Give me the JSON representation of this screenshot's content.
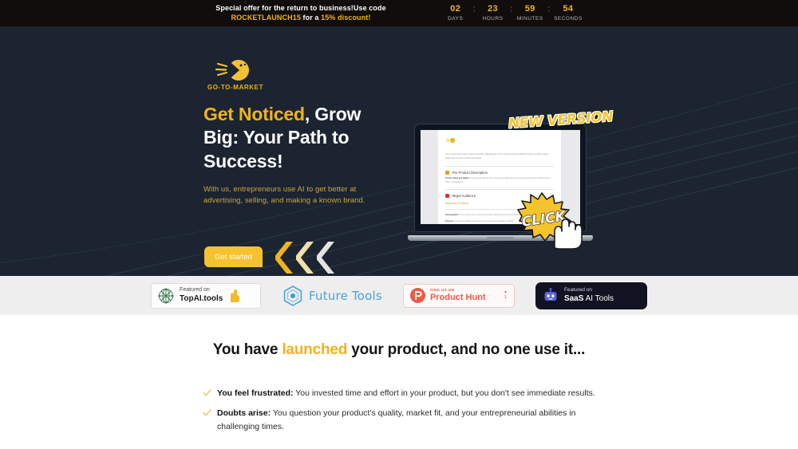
{
  "promo": {
    "line1": "Special offer for the return to business!Use code",
    "line2_code": "ROCKETLAUNCH15",
    "line2_mid": " for a ",
    "line2_pct": "15% discount!",
    "countdown": [
      {
        "value": "02",
        "label": "DAYS"
      },
      {
        "value": "23",
        "label": "HOURS"
      },
      {
        "value": "59",
        "label": "MINUTES"
      },
      {
        "value": "54",
        "label": "SECONDS"
      }
    ],
    "separator": ":"
  },
  "hero": {
    "logo_text": "GO-TO-MARKET",
    "logo_icon": "megaphone-face-icon",
    "headline_accent": "Get Noticed",
    "headline_rest": ", Grow Big: Your Path to Success!",
    "subheading": "With us, entrepreneurs use AI to get better at advertising, selling, and making a known brand.",
    "cta_label": "Get started",
    "chevrons_icon": "triple-chevron-left-icon",
    "new_version_badge": "NEW VERSION",
    "click_badge": "CLICK",
    "hand_icon": "pointing-hand-icon",
    "mock_document": {
      "intro": "Lorem ipsum dolor sit amet consectetur adipiscing elit, sed do eiusmod tempor incididunt ut labore et dolore magna aliqua enim ad minim veniam quis nostrud.",
      "intro_link": "https://",
      "sections": [
        {
          "icon": "building-icon",
          "heading": "The Product Description",
          "body_lead": "Product Name and Tagline:",
          "body": " Lorem ipsum dolor sit amet consectetur adipiscing elit sed do eiusmod tempor incididunt labore dolore magna aliqua."
        },
        {
          "icon": "flag-icon",
          "heading": "Target Audience",
          "subheading": "Audience Profiling",
          "body_lead": "Demographics:",
          "body": " Lorem ipsum dolor sit amet consectetur adipiscing elit sed do eiusmod tempor.",
          "body2_lead": "Interests:",
          "body2": " Consectetur adipiscing elit sed do eiusmod tempor incididunt ut labore."
        }
      ]
    }
  },
  "badges": {
    "topai": {
      "line1": "Featured on",
      "line2": "TopAI.tools",
      "icon": "topai-network-icon",
      "hand_icon": "pointing-hand-icon"
    },
    "futuretools": {
      "label": "Future Tools",
      "icon": "future-tools-hex-icon"
    },
    "producthunt": {
      "line1": "FIND US ON",
      "line2": "Product Hunt",
      "icon": "product-hunt-icon",
      "upvote_icon": "upvote-arrow-icon",
      "upvote_count": "1"
    },
    "saas": {
      "line1": "Featured on",
      "line2_bold": "SaaS",
      "line2_rest": " AI Tools",
      "icon": "robot-icon"
    }
  },
  "problem": {
    "title_before": "You have ",
    "title_accent": "launched",
    "title_after": " your product, and no one use it...",
    "items": [
      {
        "icon": "check-icon",
        "lead": "You feel frustrated:",
        "text": " You invested time and effort in your product, but you don't see immediate results."
      },
      {
        "icon": "check-icon",
        "lead": "Doubts arise:",
        "text": " You question your product's quality, market fit, and your entrepreneurial abilities in challenging times."
      }
    ]
  },
  "colors": {
    "brand_yellow": "#f2b21b",
    "hero_bg": "#1b2430",
    "promo_bg": "#100d0a",
    "strip_bg": "#eeeeee"
  }
}
